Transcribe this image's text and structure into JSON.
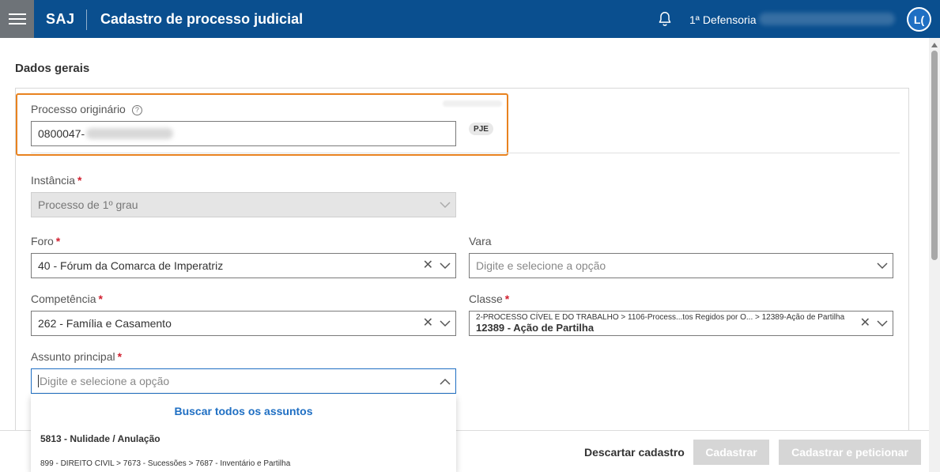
{
  "header": {
    "brand": "SAJ",
    "title": "Cadastro de processo judicial",
    "organization": "1ª Defensoria",
    "avatar_initials": "L("
  },
  "section": {
    "title": "Dados gerais"
  },
  "fields": {
    "processo_originario": {
      "label": "Processo originário",
      "value": "0800047-",
      "badge": "PJE"
    },
    "instancia": {
      "label": "Instância",
      "value": "Processo de 1º grau"
    },
    "foro": {
      "label": "Foro",
      "value": "40 - Fórum da Comarca de Imperatriz"
    },
    "vara": {
      "label": "Vara",
      "placeholder": "Digite e selecione a opção"
    },
    "competencia": {
      "label": "Competência",
      "value": "262 - Família e Casamento"
    },
    "classe": {
      "label": "Classe",
      "path": "2-PROCESSO CÍVEL E DO TRABALHO > 1106-Process...tos Regidos por O... > 12389-Ação de Partilha",
      "value": "12389 - Ação de Partilha"
    },
    "assunto_principal": {
      "label": "Assunto principal",
      "placeholder": "Digite e selecione a opção"
    }
  },
  "dropdown": {
    "search_all": "Buscar todos os assuntos",
    "items": [
      {
        "title": "5813 - Nulidade / Anulação",
        "path": "899 - DIREITO CIVIL > 7673 - Sucessões > 7687 - Inventário e Partilha"
      }
    ]
  },
  "footer": {
    "discard": "Descartar cadastro",
    "submit": "Cadastrar",
    "submit_petition": "Cadastrar e peticionar"
  },
  "colors": {
    "header_bg": "#0a4f8f",
    "highlight": "#e8821f",
    "link": "#1f6fc3",
    "required": "#d11f2f"
  }
}
